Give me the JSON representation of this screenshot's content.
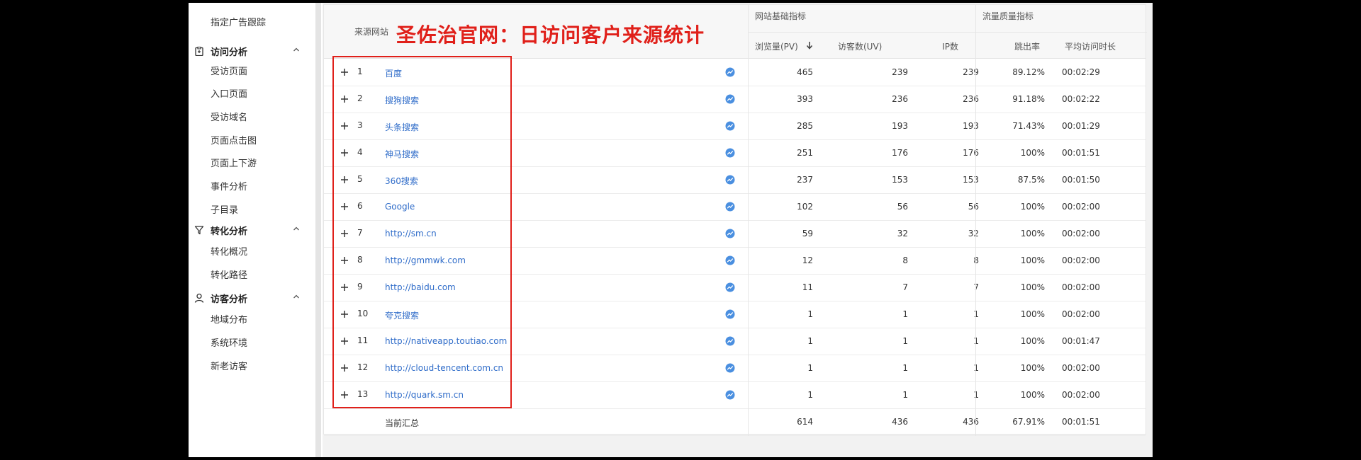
{
  "sidebar": {
    "top_item": "指定广告跟踪",
    "groups": [
      {
        "label": "访问分析",
        "icon": "clipboard-icon",
        "items": [
          "受访页面",
          "入口页面",
          "受访域名",
          "页面点击图",
          "页面上下游",
          "事件分析",
          "子目录"
        ]
      },
      {
        "label": "转化分析",
        "icon": "funnel-icon",
        "items": [
          "转化概况",
          "转化路径"
        ]
      },
      {
        "label": "访客分析",
        "icon": "user-icon",
        "items": [
          "地域分布",
          "系统环境",
          "新老访客"
        ]
      }
    ]
  },
  "title_overlay": "圣佐治官网：日访问客户来源统计",
  "table": {
    "col_source": "来源网站",
    "group_basic": "网站基础指标",
    "group_quality": "流量质量指标",
    "col_pv": "浏览量(PV)",
    "col_uv": "访客数(UV)",
    "col_ip": "IP数",
    "col_bounce": "跳出率",
    "col_avgtime": "平均访问时长",
    "rows": [
      {
        "idx": "1",
        "source": "百度",
        "pv": "465",
        "uv": "239",
        "ip": "239",
        "bounce": "89.12%",
        "time": "00:02:29"
      },
      {
        "idx": "2",
        "source": "搜狗搜索",
        "pv": "393",
        "uv": "236",
        "ip": "236",
        "bounce": "91.18%",
        "time": "00:02:22"
      },
      {
        "idx": "3",
        "source": "头条搜索",
        "pv": "285",
        "uv": "193",
        "ip": "193",
        "bounce": "71.43%",
        "time": "00:01:29"
      },
      {
        "idx": "4",
        "source": "神马搜索",
        "pv": "251",
        "uv": "176",
        "ip": "176",
        "bounce": "100%",
        "time": "00:01:51"
      },
      {
        "idx": "5",
        "source": "360搜索",
        "pv": "237",
        "uv": "153",
        "ip": "153",
        "bounce": "87.5%",
        "time": "00:01:50"
      },
      {
        "idx": "6",
        "source": "Google",
        "pv": "102",
        "uv": "56",
        "ip": "56",
        "bounce": "100%",
        "time": "00:02:00"
      },
      {
        "idx": "7",
        "source": "http://sm.cn",
        "pv": "59",
        "uv": "32",
        "ip": "32",
        "bounce": "100%",
        "time": "00:02:00"
      },
      {
        "idx": "8",
        "source": "http://gmmwk.com",
        "pv": "12",
        "uv": "8",
        "ip": "8",
        "bounce": "100%",
        "time": "00:02:00"
      },
      {
        "idx": "9",
        "source": "http://baidu.com",
        "pv": "11",
        "uv": "7",
        "ip": "7",
        "bounce": "100%",
        "time": "00:02:00"
      },
      {
        "idx": "10",
        "source": "夸克搜索",
        "pv": "1",
        "uv": "1",
        "ip": "1",
        "bounce": "100%",
        "time": "00:02:00"
      },
      {
        "idx": "11",
        "source": "http://nativeapp.toutiao.com",
        "pv": "1",
        "uv": "1",
        "ip": "1",
        "bounce": "100%",
        "time": "00:01:47"
      },
      {
        "idx": "12",
        "source": "http://cloud-tencent.com.cn",
        "pv": "1",
        "uv": "1",
        "ip": "1",
        "bounce": "100%",
        "time": "00:02:00"
      },
      {
        "idx": "13",
        "source": "http://quark.sm.cn",
        "pv": "1",
        "uv": "1",
        "ip": "1",
        "bounce": "100%",
        "time": "00:02:00"
      }
    ],
    "total": {
      "label": "当前汇总",
      "pv": "614",
      "uv": "436",
      "ip": "436",
      "bounce": "67.91%",
      "time": "00:01:51"
    }
  },
  "colors": {
    "accent_red": "#e0201a",
    "link_blue": "#2f6cc9",
    "trend_icon": "#4a8fe0"
  }
}
